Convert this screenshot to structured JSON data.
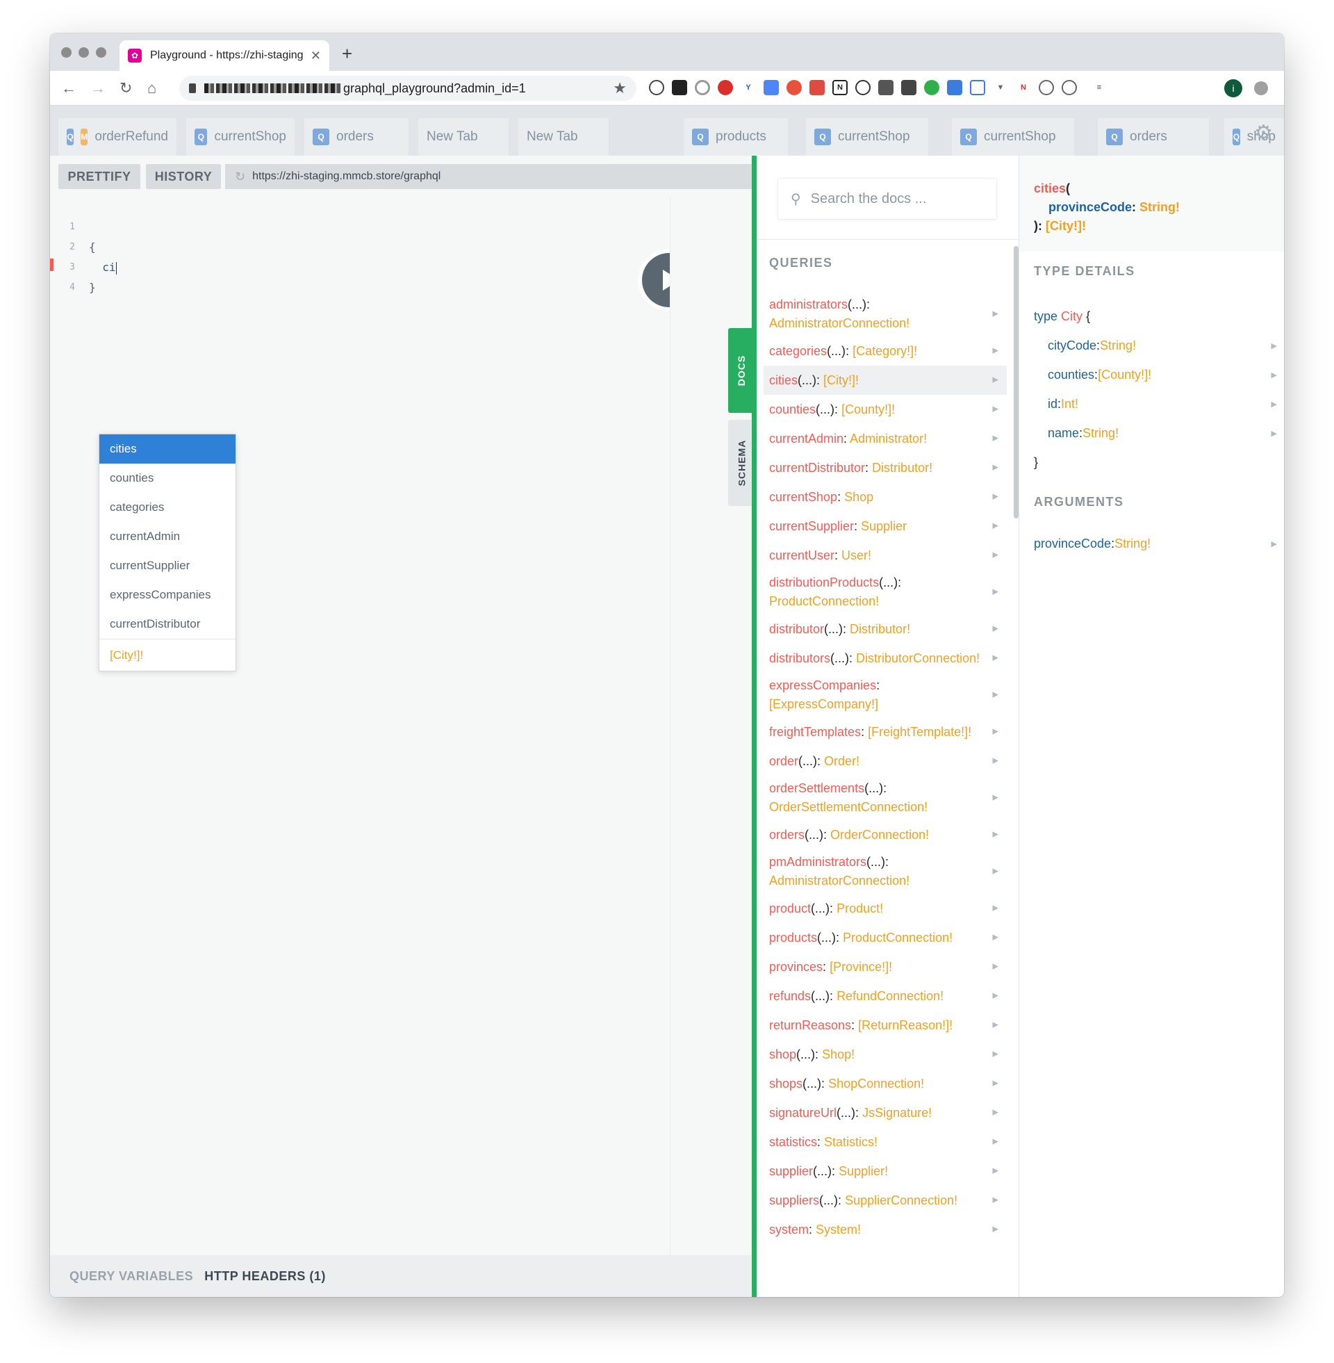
{
  "browser": {
    "tab_title": "Playground - https://zhi-staging",
    "tab_close": "✕",
    "new_tab": "+",
    "url_visible": "graphql_playground?admin_id=1",
    "profile_initial": "i"
  },
  "playground_tabs": [
    {
      "badges": [
        "Q",
        "M"
      ],
      "label": "orderRefund"
    },
    {
      "badges": [
        "Q"
      ],
      "label": "currentShop"
    },
    {
      "badges": [
        "Q"
      ],
      "label": "orders"
    },
    {
      "badges": [],
      "label": "New Tab"
    },
    {
      "badges": [],
      "label": "New Tab"
    },
    {
      "badges": [
        "Q"
      ],
      "label": "products"
    },
    {
      "badges": [
        "Q"
      ],
      "label": "currentShop"
    },
    {
      "badges": [
        "Q"
      ],
      "label": "currentShop"
    },
    {
      "badges": [
        "Q"
      ],
      "label": "orders"
    },
    {
      "badges": [
        "Q"
      ],
      "label": "shop"
    }
  ],
  "editor": {
    "prettify_label": "PRETTIFY",
    "history_label": "HISTORY",
    "endpoint": "https://zhi-staging.mmcb.store/graphql",
    "line_numbers": [
      "1",
      "2",
      "3",
      "4"
    ],
    "lines": [
      "",
      "{",
      "  ci",
      "}"
    ],
    "autocomplete": {
      "items": [
        "cities",
        "counties",
        "categories",
        "currentAdmin",
        "currentSupplier",
        "expressCompanies",
        "currentDistributor"
      ],
      "active_index": 0,
      "type_hint": "[City!]!"
    },
    "side_tabs": {
      "docs": "DOCS",
      "schema": "SCHEMA"
    },
    "bottom": {
      "query_variables": "QUERY VARIABLES",
      "http_headers": "HTTP HEADERS (1)"
    }
  },
  "docs": {
    "search_placeholder": "Search the docs ...",
    "queries_heading": "QUERIES",
    "queries": [
      {
        "name": "administrators",
        "args": "(...)",
        "type": "AdministratorConnection!",
        "wrap": true
      },
      {
        "name": "categories",
        "args": "(...)",
        "type": "[Category!]!"
      },
      {
        "name": "cities",
        "args": "(...)",
        "type": "[City!]!",
        "highlighted": true
      },
      {
        "name": "counties",
        "args": "(...)",
        "type": "[County!]!"
      },
      {
        "name": "currentAdmin",
        "args": "",
        "type": "Administrator!"
      },
      {
        "name": "currentDistributor",
        "args": "",
        "type": "Distributor!"
      },
      {
        "name": "currentShop",
        "args": "",
        "type": "Shop"
      },
      {
        "name": "currentSupplier",
        "args": "",
        "type": "Supplier"
      },
      {
        "name": "currentUser",
        "args": "",
        "type": "User!"
      },
      {
        "name": "distributionProducts",
        "args": "(...)",
        "type": "ProductConnection!",
        "wrap": true
      },
      {
        "name": "distributor",
        "args": "(...)",
        "type": "Distributor!"
      },
      {
        "name": "distributors",
        "args": "(...)",
        "type": "DistributorConnection!"
      },
      {
        "name": "expressCompanies",
        "args": "",
        "type": "[ExpressCompany!]",
        "wrap": true
      },
      {
        "name": "freightTemplates",
        "args": "",
        "type": "[FreightTemplate!]!"
      },
      {
        "name": "order",
        "args": "(...)",
        "type": "Order!"
      },
      {
        "name": "orderSettlements",
        "args": "(...)",
        "type": "OrderSettlementConnection!",
        "wrap": true
      },
      {
        "name": "orders",
        "args": "(...)",
        "type": "OrderConnection!"
      },
      {
        "name": "pmAdministrators",
        "args": "(...)",
        "type": "AdministratorConnection!",
        "wrap": true
      },
      {
        "name": "product",
        "args": "(...)",
        "type": "Product!"
      },
      {
        "name": "products",
        "args": "(...)",
        "type": "ProductConnection!"
      },
      {
        "name": "provinces",
        "args": "",
        "type": "[Province!]!"
      },
      {
        "name": "refunds",
        "args": "(...)",
        "type": "RefundConnection!"
      },
      {
        "name": "returnReasons",
        "args": "",
        "type": "[ReturnReason!]!"
      },
      {
        "name": "shop",
        "args": "(...)",
        "type": "Shop!"
      },
      {
        "name": "shops",
        "args": "(...)",
        "type": "ShopConnection!"
      },
      {
        "name": "signatureUrl",
        "args": "(...)",
        "type": "JsSignature!"
      },
      {
        "name": "statistics",
        "args": "",
        "type": "Statistics!"
      },
      {
        "name": "supplier",
        "args": "(...)",
        "type": "Supplier!"
      },
      {
        "name": "suppliers",
        "args": "(...)",
        "type": "SupplierConnection!"
      },
      {
        "name": "system",
        "args": "",
        "type": "System!"
      }
    ],
    "detail": {
      "field_name": "cities",
      "arg_name": "provinceCode",
      "arg_type": "String!",
      "return_type": "[City!]!",
      "type_details_heading": "TYPE DETAILS",
      "type_keyword": "type",
      "type_name": "City",
      "open_brace": "{",
      "close_brace": "}",
      "fields": [
        {
          "name": "cityCode",
          "type": "String!"
        },
        {
          "name": "counties",
          "type": "[County!]!"
        },
        {
          "name": "id",
          "type": "Int!"
        },
        {
          "name": "name",
          "type": "String!"
        }
      ],
      "arguments_heading": "ARGUMENTS",
      "arguments": [
        {
          "name": "provinceCode",
          "type": "String!"
        }
      ]
    }
  }
}
